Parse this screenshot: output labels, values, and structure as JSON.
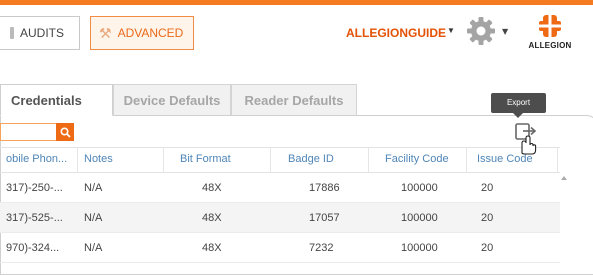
{
  "header": {
    "audits_label": "AUDITS",
    "advanced_label": "ADVANCED",
    "user_label": "ALLEGIONGUIDE",
    "logo_text": "ALLEGION",
    "accent_color": "#f47b20"
  },
  "tabs": [
    {
      "label": "Credentials",
      "active": true
    },
    {
      "label": "Device Defaults",
      "active": false
    },
    {
      "label": "Reader Defaults",
      "active": false
    }
  ],
  "search": {
    "value": "",
    "icon": "search-icon"
  },
  "tooltip": {
    "export_label": "Export"
  },
  "table": {
    "headers": [
      "obile Phon...",
      "Notes",
      "Bit Format",
      "Badge ID",
      "Facility Code",
      "Issue Code"
    ],
    "rows": [
      [
        "317)-250-...",
        "N/A",
        "48X",
        "17886",
        "100000",
        "20"
      ],
      [
        "317)-525-...",
        "N/A",
        "48X",
        "17057",
        "100000",
        "20"
      ],
      [
        "970)-324...",
        "N/A",
        "48X",
        "7232",
        "100000",
        "20"
      ]
    ]
  }
}
